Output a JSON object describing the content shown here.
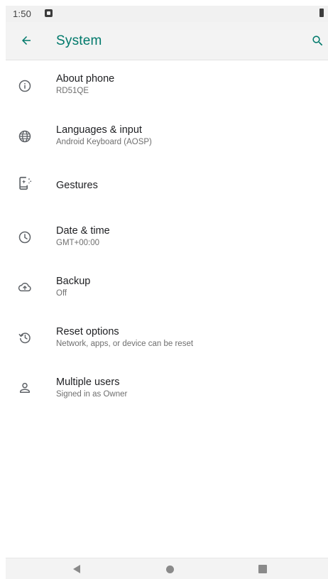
{
  "status_bar": {
    "time": "1:50",
    "notification_icon": "notification-a-icon",
    "battery_icon": "battery-icon"
  },
  "app_bar": {
    "title": "System",
    "back_icon": "arrow-back-icon",
    "search_icon": "search-icon"
  },
  "colors": {
    "accent": "#00796b",
    "text_primary": "#202124",
    "text_secondary": "#6f6f6f",
    "icon": "#5f6368"
  },
  "items": [
    {
      "icon": "info-icon",
      "title": "About phone",
      "summary": "RD51QE"
    },
    {
      "icon": "globe-icon",
      "title": "Languages & input",
      "summary": "Android Keyboard (AOSP)"
    },
    {
      "icon": "gestures-icon",
      "title": "Gestures",
      "summary": ""
    },
    {
      "icon": "clock-icon",
      "title": "Date & time",
      "summary": "GMT+00:00"
    },
    {
      "icon": "cloud-backup-icon",
      "title": "Backup",
      "summary": "Off"
    },
    {
      "icon": "reset-history-icon",
      "title": "Reset options",
      "summary": "Network, apps, or device can be reset"
    },
    {
      "icon": "person-icon",
      "title": "Multiple users",
      "summary": "Signed in as Owner"
    }
  ],
  "nav_bar": {
    "back_icon": "nav-back-icon",
    "home_icon": "nav-home-icon",
    "recents_icon": "nav-recents-icon"
  }
}
